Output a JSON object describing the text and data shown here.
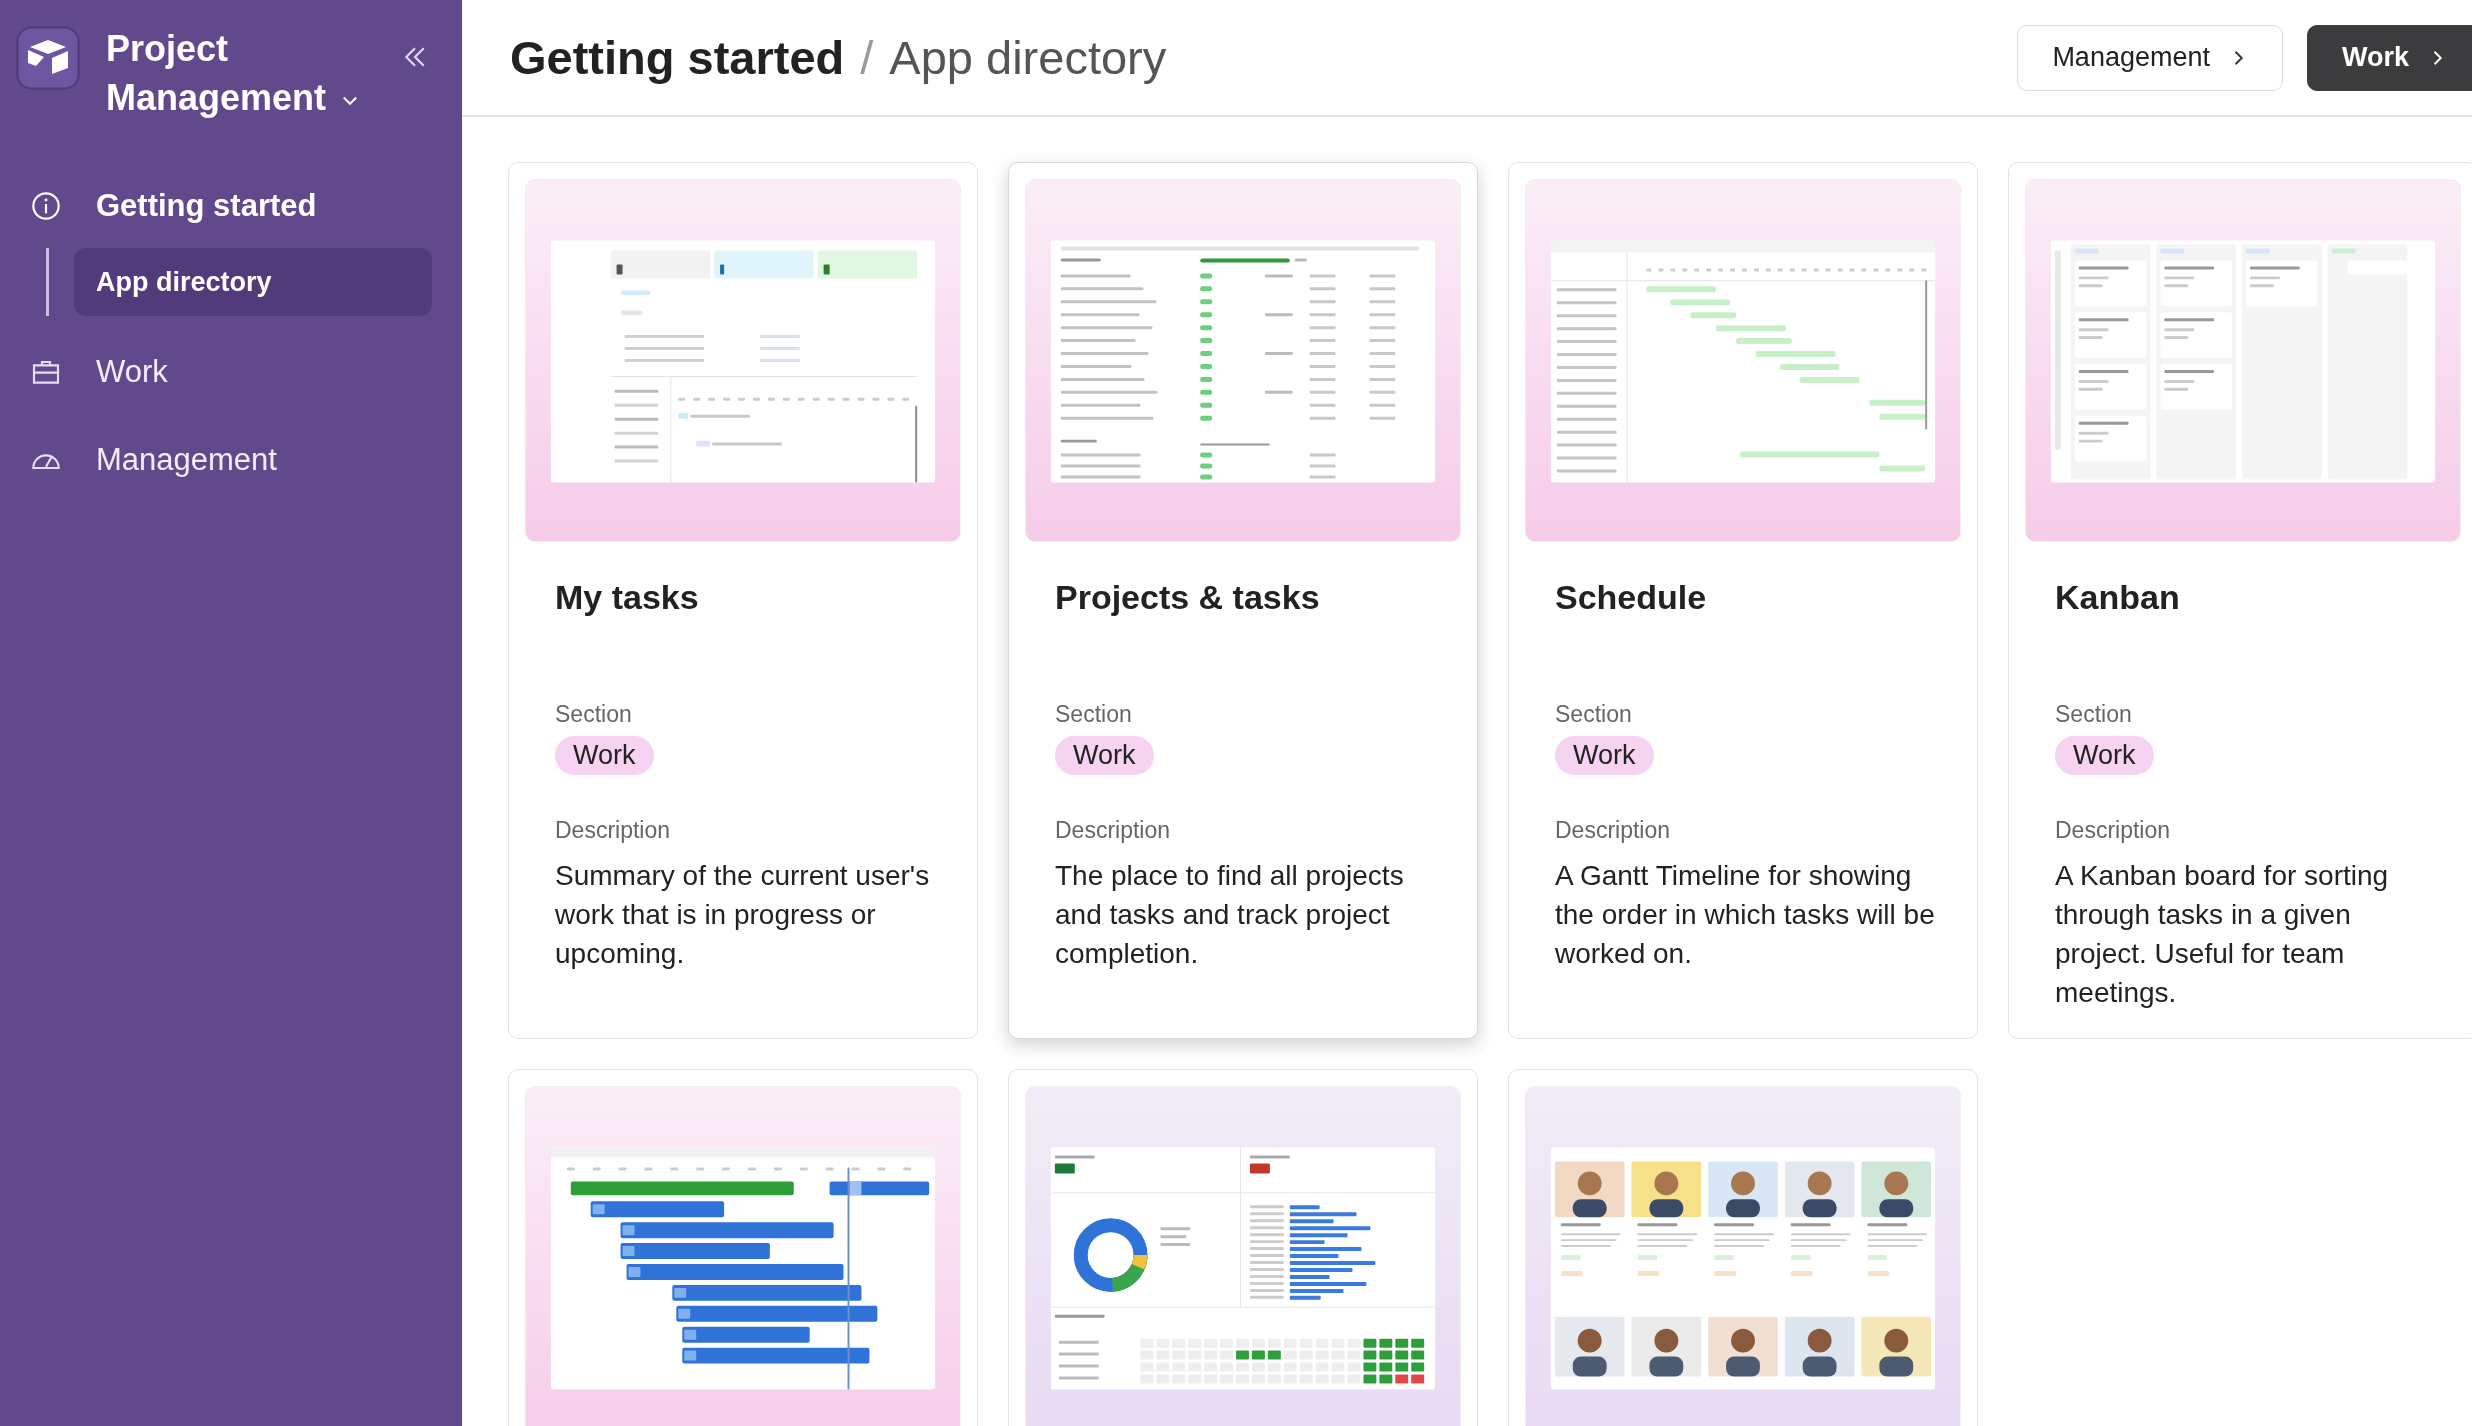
{
  "sidebar": {
    "app_title": "Project Management",
    "items": [
      {
        "label": "Getting started",
        "selected": false,
        "children": [
          {
            "label": "App directory",
            "selected": true
          }
        ]
      },
      {
        "label": "Work",
        "selected": false
      },
      {
        "label": "Management",
        "selected": false
      }
    ]
  },
  "header": {
    "breadcrumb": [
      "Getting started",
      "App directory"
    ],
    "breadcrumb_separator": "/",
    "buttons": [
      {
        "label": "Management",
        "kind": "outline"
      },
      {
        "label": "Work",
        "kind": "dark"
      }
    ]
  },
  "cards": [
    {
      "kind": "tasks",
      "highlighted": false,
      "title": "My tasks",
      "section_label": "Section",
      "section": "Work",
      "description_label": "Description",
      "description": "Summary of the current user's work that is in progress or upcoming."
    },
    {
      "kind": "table",
      "highlighted": true,
      "title": "Projects & tasks",
      "section_label": "Section",
      "section": "Work",
      "description_label": "Description",
      "description": "The place to find all projects and tasks and track project completion."
    },
    {
      "kind": "gantt",
      "highlighted": false,
      "title": "Schedule",
      "section_label": "Section",
      "section": "Work",
      "description_label": "Description",
      "description": "A Gantt Timeline for showing the order in which tasks will be worked on."
    },
    {
      "kind": "kanban",
      "highlighted": false,
      "title": "Kanban",
      "section_label": "Section",
      "section": "Work",
      "description_label": "Description",
      "description": "A Kanban board for sorting through tasks in a given project. Useful for team meetings."
    },
    {
      "kind": "timeline",
      "highlighted": false
    },
    {
      "kind": "dashboard",
      "highlighted": false
    },
    {
      "kind": "people",
      "highlighted": false
    }
  ]
}
